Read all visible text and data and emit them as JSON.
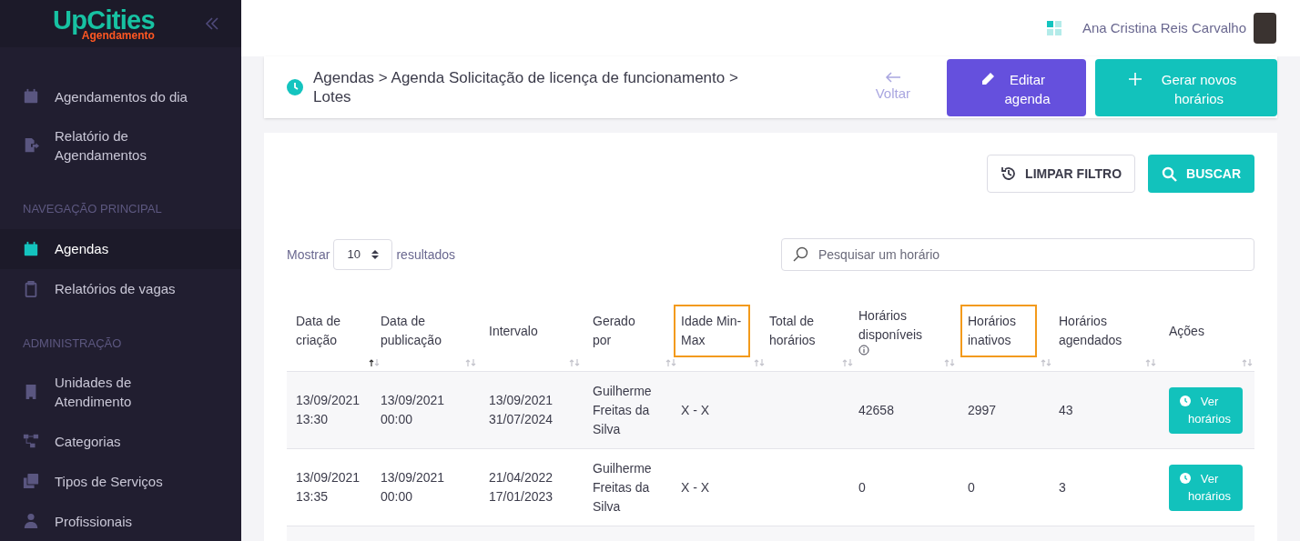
{
  "logo": {
    "name": "UpCities",
    "subtitle": "Agendamento"
  },
  "sidebar": {
    "items": [
      {
        "kind": "item",
        "label": "Agendamentos do dia",
        "selected": false
      },
      {
        "kind": "item",
        "label": "Relatório de Agendamentos",
        "selected": false
      },
      {
        "kind": "section",
        "label": "NAVEGAÇÃO PRINCIPAL"
      },
      {
        "kind": "item",
        "label": "Agendas",
        "selected": true
      },
      {
        "kind": "item",
        "label": "Relatórios de vagas",
        "selected": false
      },
      {
        "kind": "section",
        "label": "ADMINISTRAÇÃO"
      },
      {
        "kind": "item",
        "label": "Unidades de Atendimento",
        "selected": false
      },
      {
        "kind": "item",
        "label": "Categorias",
        "selected": false
      },
      {
        "kind": "item",
        "label": "Tipos de Serviços",
        "selected": false
      },
      {
        "kind": "item",
        "label": "Profissionais",
        "selected": false
      }
    ]
  },
  "header": {
    "user_name": "Ana Cristina Reis Carvalho"
  },
  "page_header": {
    "breadcrumb": "Agendas > Agenda Solicitação de licença de funcionamento > Lotes",
    "back": "Voltar",
    "edit_button": "Editar agenda",
    "generate_button": "Gerar novos horários"
  },
  "filters": {
    "clear_button": "LIMPAR FILTRO",
    "search_button": "BUSCAR"
  },
  "table_controls": {
    "show_label": "Mostrar",
    "page_size": "10",
    "results_label": "resultados",
    "search_placeholder": "Pesquisar um horário"
  },
  "table": {
    "columns": [
      {
        "label": "Data de criação",
        "sorted": true,
        "highlighted": false,
        "info": false
      },
      {
        "label": "Data de publicação",
        "sorted": false,
        "highlighted": false,
        "info": false
      },
      {
        "label": "Intervalo",
        "sorted": false,
        "highlighted": false,
        "info": false
      },
      {
        "label": "Gerado por",
        "sorted": false,
        "highlighted": false,
        "info": false
      },
      {
        "label": "Idade Min-Max",
        "sorted": false,
        "highlighted": true,
        "info": false
      },
      {
        "label": "Total de horários",
        "sorted": false,
        "highlighted": false,
        "info": false
      },
      {
        "label": "Horários disponíveis",
        "sorted": false,
        "highlighted": false,
        "info": true
      },
      {
        "label": "Horários inativos",
        "sorted": false,
        "highlighted": true,
        "info": false
      },
      {
        "label": "Horários agendados",
        "sorted": false,
        "highlighted": false,
        "info": false
      },
      {
        "label": "Ações",
        "sorted": false,
        "highlighted": false,
        "info": false
      }
    ],
    "rows": [
      {
        "cells": [
          "13/09/2021 13:30",
          "13/09/2021 00:00",
          "13/09/2021 31/07/2024",
          "Guilherme Freitas da Silva",
          "X - X",
          "",
          "42658",
          "2997",
          "43"
        ],
        "action": "Ver horários"
      },
      {
        "cells": [
          "13/09/2021 13:35",
          "13/09/2021 00:00",
          "21/04/2022 17/01/2023",
          "Guilherme Freitas da Silva",
          "X - X",
          "",
          "0",
          "0",
          "3"
        ],
        "action": "Ver horários"
      }
    ]
  }
}
